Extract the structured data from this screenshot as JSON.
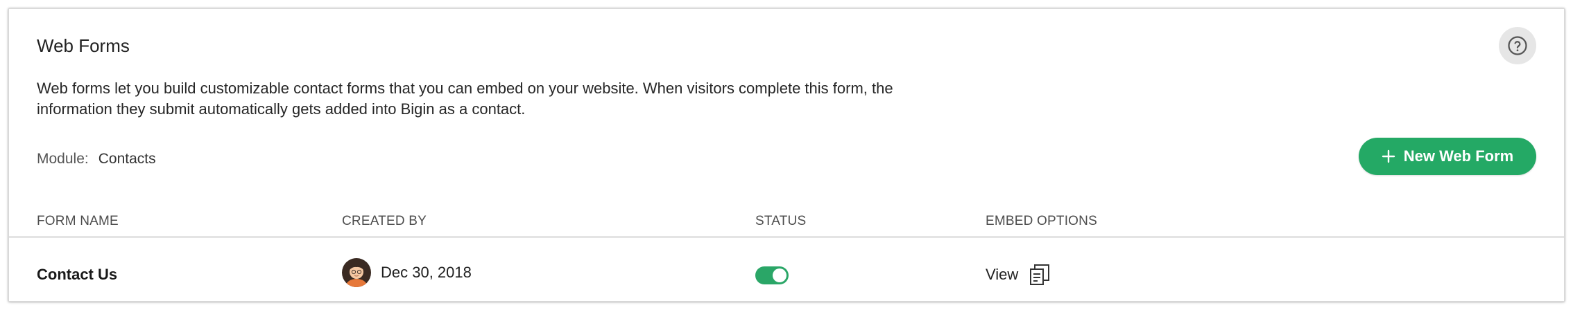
{
  "header": {
    "title": "Web Forms",
    "help_icon": "help-circle-icon"
  },
  "description": {
    "line1": "Web forms let you build customizable contact forms that you can embed on your website. When visitors complete this form, the",
    "line2": "information they submit automatically gets added into Bigin as a contact."
  },
  "module": {
    "label": "Module:",
    "value": "Contacts"
  },
  "actions": {
    "new_web_form": "New Web Form",
    "new_web_form_icon": "plus-icon",
    "accent_color": "#24a965"
  },
  "table": {
    "columns": [
      "FORM NAME",
      "CREATED BY",
      "STATUS",
      "EMBED OPTIONS"
    ],
    "rows": [
      {
        "form_name": "Contact Us",
        "created_by_avatar": "user-avatar",
        "created_date": "Dec 30, 2018",
        "status_enabled": true,
        "embed_view": "View",
        "embed_icon": "copy-icon"
      }
    ]
  }
}
